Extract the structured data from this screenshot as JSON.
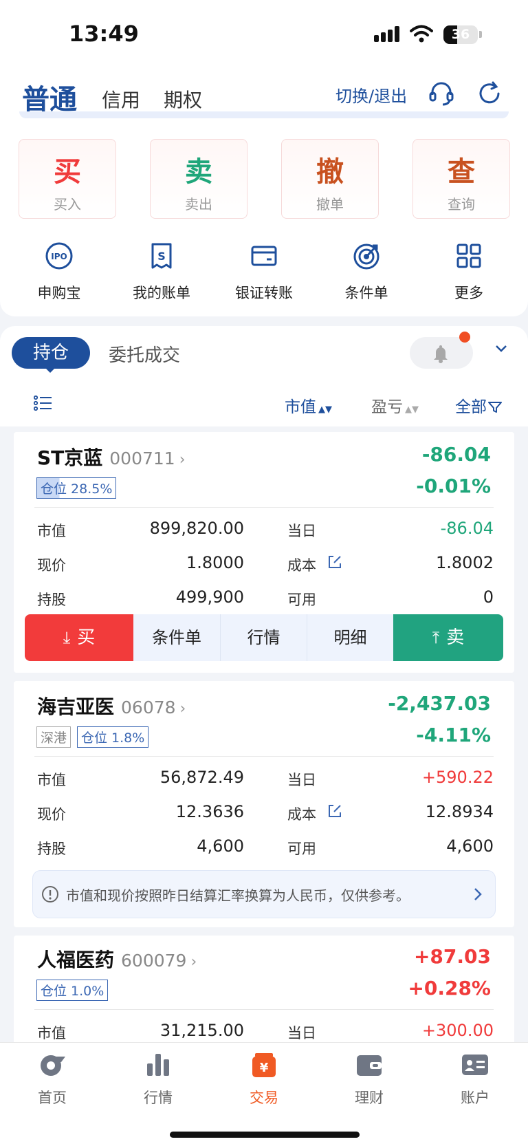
{
  "status_bar": {
    "time": "13:49",
    "battery": "36"
  },
  "header": {
    "account_tabs": [
      "普通",
      "信用",
      "期权"
    ],
    "switch_label": "切换/退出",
    "support_icon": "headset-icon",
    "refresh_icon": "refresh-icon"
  },
  "trade_actions": [
    {
      "big": "买",
      "small": "买入",
      "color": "#f03b3b"
    },
    {
      "big": "卖",
      "small": "卖出",
      "color": "#1fa67a"
    },
    {
      "big": "撤",
      "small": "撤单",
      "color": "#c8511f"
    },
    {
      "big": "查",
      "small": "查询",
      "color": "#c8511f"
    }
  ],
  "quick_links": [
    {
      "label": "申购宝",
      "icon": "ipo-icon"
    },
    {
      "label": "我的账单",
      "icon": "bill-icon"
    },
    {
      "label": "银证转账",
      "icon": "wallet-card-icon"
    },
    {
      "label": "条件单",
      "icon": "target-icon"
    },
    {
      "label": "更多",
      "icon": "grid-icon"
    }
  ],
  "positions": {
    "tabs": [
      "持仓",
      "委托成交"
    ],
    "sort": {
      "market_value": "市值",
      "profit": "盈亏",
      "filter": "全部"
    }
  },
  "holdings": [
    {
      "name": "ST京蓝",
      "code": "000711",
      "pl": "-86.04",
      "pl_pct": "-0.01%",
      "tags": [
        "仓位 28.5%"
      ],
      "rows": {
        "mv_label": "市值",
        "mv": "899,820.00",
        "day_label": "当日",
        "day": "-86.04",
        "price_label": "现价",
        "price": "1.8000",
        "cost_label": "成本",
        "cost": "1.8002",
        "shares_label": "持股",
        "shares": "499,900",
        "avail_label": "可用",
        "avail": "0"
      },
      "actions": [
        "买",
        "条件单",
        "行情",
        "明细",
        "卖"
      ]
    },
    {
      "name": "海吉亚医",
      "code": "06078",
      "pl": "-2,437.03",
      "pl_pct": "-4.11%",
      "tags": [
        "深港",
        "仓位 1.8%"
      ],
      "rows": {
        "mv_label": "市值",
        "mv": "56,872.49",
        "day_label": "当日",
        "day": "+590.22",
        "price_label": "现价",
        "price": "12.3636",
        "cost_label": "成本",
        "cost": "12.8934",
        "shares_label": "持股",
        "shares": "4,600",
        "avail_label": "可用",
        "avail": "4,600"
      },
      "notice": "市值和现价按照昨日结算汇率换算为人民币，仅供参考。"
    },
    {
      "name": "人福医药",
      "code": "600079",
      "pl": "+87.03",
      "pl_pct": "+0.28%",
      "tags": [
        "仓位 1.0%"
      ],
      "rows": {
        "mv_label": "市值",
        "mv": "31,215.00",
        "day_label": "当日",
        "day": "+300.00"
      }
    }
  ],
  "tabbar": [
    {
      "label": "首页",
      "icon": "home-icon"
    },
    {
      "label": "行情",
      "icon": "bar-chart-icon"
    },
    {
      "label": "交易",
      "icon": "yen-bag-icon"
    },
    {
      "label": "理财",
      "icon": "wallet-icon"
    },
    {
      "label": "账户",
      "icon": "id-card-icon"
    }
  ],
  "colors": {
    "brand": "#1e4f9c",
    "up": "#f03b3b",
    "down": "#1fa67a",
    "accent": "#f05a24"
  }
}
